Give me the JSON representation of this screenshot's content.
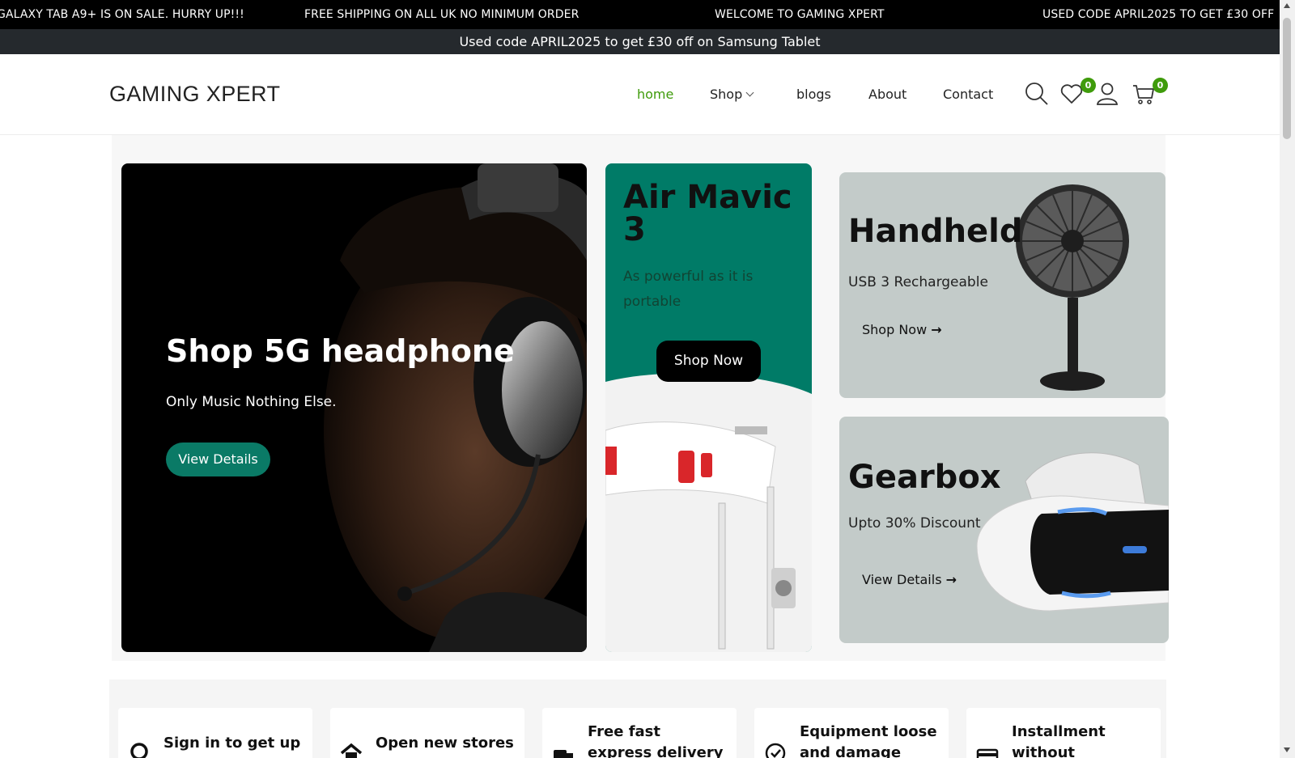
{
  "ticker": [
    "GALAXY TAB A9+ IS ON SALE. HURRY UP!!!",
    "FREE SHIPPING ON ALL UK NO MINIMUM ORDER",
    "WELCOME TO GAMING XPERT",
    "USED CODE APRIL2025 TO GET £30 OFF"
  ],
  "promo": "Used code APRIL2025 to get £30 off on Samsung Tablet",
  "header": {
    "logo": "GAMING XPERT",
    "nav": [
      "home",
      "Shop",
      "blogs",
      "About",
      "Contact"
    ],
    "wishlist_count": "0",
    "cart_count": "0",
    "accent": "#3f9b0b"
  },
  "hero": {
    "title": "Shop 5G headphone",
    "subtitle": "Only Music Nothing Else.",
    "button": "View Details"
  },
  "drone_card": {
    "title": "Air Mavic 3",
    "subtitle": "As powerful as it is portable",
    "button": "Shop Now"
  },
  "fan_card": {
    "title": "Handheld",
    "subtitle": "USB 3 Rechargeable",
    "link": "Shop Now"
  },
  "vr_card": {
    "title": "Gearbox",
    "subtitle": "Upto 30% Discount",
    "link": "View Details"
  },
  "features": [
    {
      "text": "Sign in to get up to",
      "icon": "user-icon"
    },
    {
      "text": "Open new stores",
      "icon": "home-icon"
    },
    {
      "text": "Free fast express delivery with",
      "icon": "truck-icon"
    },
    {
      "text": "Equipment loose and damage",
      "icon": "check-circle-icon"
    },
    {
      "text": "Installment without",
      "icon": "credit-card-icon"
    }
  ]
}
